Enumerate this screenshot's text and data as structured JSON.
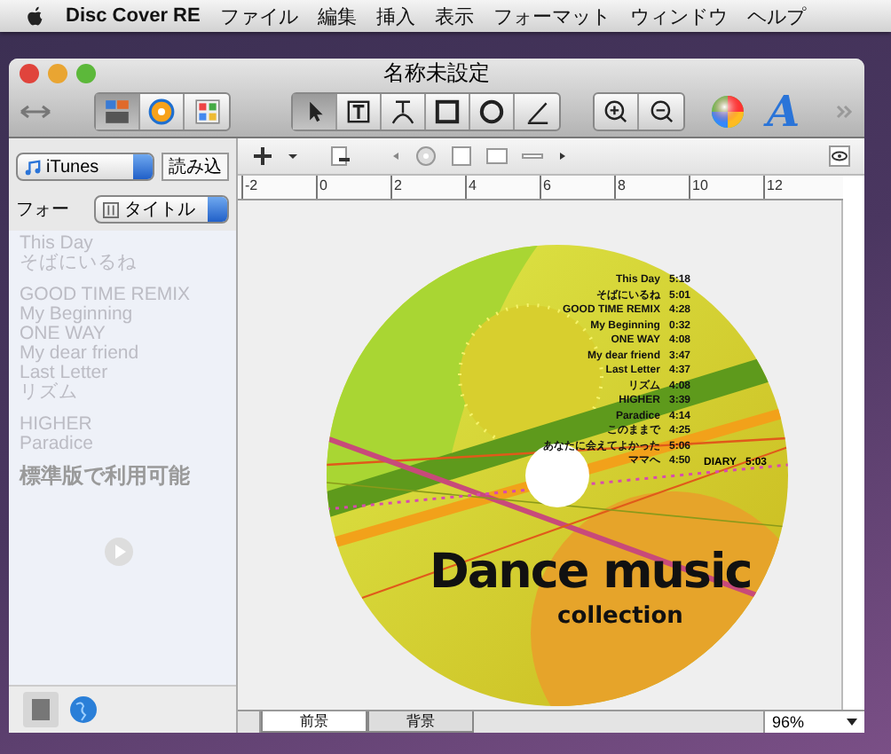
{
  "menu_bar": {
    "app_name": "Disc Cover RE",
    "items": [
      "ファイル",
      "編集",
      "挿入",
      "表示",
      "フォーマット",
      "ウィンドウ",
      "ヘルプ"
    ]
  },
  "window": {
    "title": "名称未設定"
  },
  "toolbar": {
    "views": [
      {
        "kind": "layout",
        "selected": true
      },
      {
        "kind": "disc",
        "selected": false
      },
      {
        "kind": "palette",
        "selected": false
      }
    ],
    "tools": [
      {
        "kind": "pointer",
        "selected": true
      },
      {
        "kind": "text",
        "selected": false
      },
      {
        "kind": "arc-text",
        "selected": false
      },
      {
        "kind": "rectangle",
        "selected": false
      },
      {
        "kind": "ellipse",
        "selected": false
      },
      {
        "kind": "line",
        "selected": false
      }
    ],
    "font_glyph": "A"
  },
  "sidebar": {
    "source": "iTunes",
    "load_button": "読み込",
    "field_label": "フォー",
    "field_value": "タイトル",
    "groups": [
      [
        "This Day",
        "そばにいるね"
      ],
      [
        "GOOD TIME REMIX",
        "My Beginning",
        "ONE WAY",
        "My dear friend",
        "Last Letter",
        "リズム"
      ],
      [
        "HIGHER",
        "Paradice"
      ]
    ],
    "overlay_text": "標準版で利用可能"
  },
  "ruler": [
    "-2",
    "0",
    "2",
    "4",
    "6",
    "8",
    "10",
    "12"
  ],
  "disc": {
    "tracks": [
      {
        "name": "This Day",
        "time": "5:18"
      },
      {
        "name": "そばにいるね",
        "time": "5:01"
      },
      {
        "name": "GOOD TIME REMIX",
        "time": "4:28"
      },
      {
        "name": "My Beginning",
        "time": "0:32"
      },
      {
        "name": "ONE WAY",
        "time": "4:08"
      },
      {
        "name": "My dear friend",
        "time": "3:47"
      },
      {
        "name": "Last Letter",
        "time": "4:37"
      },
      {
        "name": "リズム",
        "time": "4:08"
      },
      {
        "name": "HIGHER",
        "time": "3:39"
      },
      {
        "name": "Paradice",
        "time": "4:14"
      },
      {
        "name": "このままで",
        "time": "4:25"
      },
      {
        "name": "あなたに会えてよかった",
        "time": "5:06"
      },
      {
        "name": "ママへ",
        "time": "4:50"
      }
    ],
    "last_track": {
      "name": "DIARY",
      "time": "5:03"
    },
    "title": "Dance music",
    "subtitle": "collection"
  },
  "layer_tabs": [
    {
      "label": "前景",
      "selected": true
    },
    {
      "label": "背景",
      "selected": false
    }
  ],
  "zoom": "96%"
}
